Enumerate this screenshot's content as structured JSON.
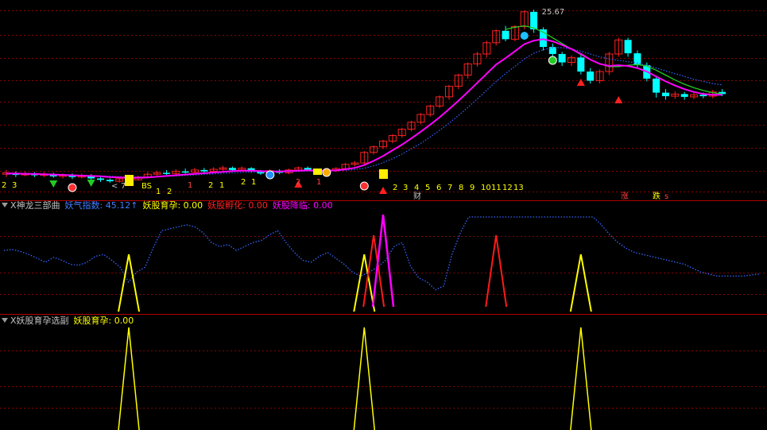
{
  "colors": {
    "background": "#000000",
    "grid": "#8a0000",
    "candle_up": "#ff2020",
    "candle_down": "#00ffff",
    "ma_fast": "#ff00ff",
    "ma_slow": "#4b7bff",
    "ma_green": "#22cc22",
    "ma_blue_dots": "#3366ff",
    "yellow": "#ffff00",
    "red": "#ff1a1a",
    "magenta": "#ff00ff",
    "label_gray": "#c0c0c0"
  },
  "main_panel": {
    "price_label": "25.67",
    "count_labels": [
      "2",
      "3",
      "1",
      "2",
      "1",
      "2",
      "1",
      "2",
      "1",
      "2",
      "1",
      "2",
      "3",
      "4",
      "5",
      "6",
      "7",
      "8",
      "9",
      "10",
      "11",
      "12",
      "13"
    ],
    "misc_labels": {
      "lt": "<",
      "seven": "7",
      "bs": "BS",
      "cai": "财",
      "zhang": "涨",
      "die": "跌",
      "s": "s"
    }
  },
  "panel2": {
    "name": "X神龙三部曲",
    "items": [
      {
        "label": "妖气指数: 45.12↑",
        "color": "#3f7fff"
      },
      {
        "label": "妖股育孕: 0.00",
        "color": "#ffff00"
      },
      {
        "label": "妖股孵化: 0.00",
        "color": "#ff2020"
      },
      {
        "label": "妖股降临: 0.00",
        "color": "#ff00ff"
      }
    ]
  },
  "panel3": {
    "name": "X妖股育孕选副",
    "items": [
      {
        "label": "妖股育孕: 0.00",
        "color": "#ffff00"
      }
    ]
  },
  "chart_data": {
    "type": "candlestick",
    "title": "",
    "candles": [
      {
        "o": 0.78,
        "c": 0.82,
        "h": 0.9,
        "l": 0.7
      },
      {
        "o": 0.82,
        "c": 0.76,
        "h": 0.86,
        "l": 0.7
      },
      {
        "o": 0.76,
        "c": 0.8,
        "h": 0.86,
        "l": 0.72
      },
      {
        "o": 0.8,
        "c": 0.75,
        "h": 0.84,
        "l": 0.7
      },
      {
        "o": 0.75,
        "c": 0.78,
        "h": 0.84,
        "l": 0.7
      },
      {
        "o": 0.78,
        "c": 0.72,
        "h": 0.82,
        "l": 0.68
      },
      {
        "o": 0.72,
        "c": 0.76,
        "h": 0.8,
        "l": 0.66
      },
      {
        "o": 0.76,
        "c": 0.7,
        "h": 0.8,
        "l": 0.64
      },
      {
        "o": 0.7,
        "c": 0.74,
        "h": 0.8,
        "l": 0.66
      },
      {
        "o": 0.74,
        "c": 0.66,
        "h": 0.78,
        "l": 0.6
      },
      {
        "o": 0.66,
        "c": 0.62,
        "h": 0.7,
        "l": 0.56
      },
      {
        "o": 0.62,
        "c": 0.58,
        "h": 0.66,
        "l": 0.54
      },
      {
        "o": 0.58,
        "c": 0.65,
        "h": 0.7,
        "l": 0.54
      },
      {
        "o": 0.65,
        "c": 0.62,
        "h": 0.72,
        "l": 0.58
      },
      {
        "o": 0.62,
        "c": 0.7,
        "h": 0.74,
        "l": 0.6
      },
      {
        "o": 0.7,
        "c": 0.78,
        "h": 0.84,
        "l": 0.66
      },
      {
        "o": 0.78,
        "c": 0.82,
        "h": 0.88,
        "l": 0.74
      },
      {
        "o": 0.82,
        "c": 0.8,
        "h": 0.9,
        "l": 0.76
      },
      {
        "o": 0.8,
        "c": 0.86,
        "h": 0.92,
        "l": 0.76
      },
      {
        "o": 0.86,
        "c": 0.84,
        "h": 0.94,
        "l": 0.8
      },
      {
        "o": 0.84,
        "c": 0.9,
        "h": 0.96,
        "l": 0.8
      },
      {
        "o": 0.9,
        "c": 0.86,
        "h": 0.96,
        "l": 0.82
      },
      {
        "o": 0.86,
        "c": 0.92,
        "h": 0.98,
        "l": 0.82
      },
      {
        "o": 0.92,
        "c": 0.96,
        "h": 1.02,
        "l": 0.88
      },
      {
        "o": 0.96,
        "c": 0.9,
        "h": 1.0,
        "l": 0.86
      },
      {
        "o": 0.9,
        "c": 0.95,
        "h": 1.0,
        "l": 0.86
      },
      {
        "o": 0.95,
        "c": 0.86,
        "h": 0.98,
        "l": 0.82
      },
      {
        "o": 0.86,
        "c": 0.8,
        "h": 0.9,
        "l": 0.76
      },
      {
        "o": 0.8,
        "c": 0.88,
        "h": 0.92,
        "l": 0.76
      },
      {
        "o": 0.88,
        "c": 0.82,
        "h": 0.92,
        "l": 0.78
      },
      {
        "o": 0.82,
        "c": 0.9,
        "h": 0.94,
        "l": 0.78
      },
      {
        "o": 0.9,
        "c": 0.96,
        "h": 1.0,
        "l": 0.86
      },
      {
        "o": 0.96,
        "c": 0.9,
        "h": 1.0,
        "l": 0.86
      },
      {
        "o": 0.9,
        "c": 0.8,
        "h": 0.94,
        "l": 0.76
      },
      {
        "o": 0.8,
        "c": 0.88,
        "h": 0.92,
        "l": 0.76
      },
      {
        "o": 0.88,
        "c": 0.94,
        "h": 0.98,
        "l": 0.84
      },
      {
        "o": 0.94,
        "c": 1.06,
        "h": 1.1,
        "l": 0.9
      },
      {
        "o": 1.06,
        "c": 1.1,
        "h": 1.16,
        "l": 1.0
      },
      {
        "o": 1.1,
        "c": 1.4,
        "h": 1.44,
        "l": 1.06
      },
      {
        "o": 1.4,
        "c": 1.56,
        "h": 1.6,
        "l": 1.34
      },
      {
        "o": 1.56,
        "c": 1.72,
        "h": 1.76,
        "l": 1.5
      },
      {
        "o": 1.72,
        "c": 1.88,
        "h": 1.92,
        "l": 1.66
      },
      {
        "o": 1.88,
        "c": 2.06,
        "h": 2.1,
        "l": 1.82
      },
      {
        "o": 2.06,
        "c": 2.26,
        "h": 2.3,
        "l": 2.0
      },
      {
        "o": 2.26,
        "c": 2.48,
        "h": 2.52,
        "l": 2.2
      },
      {
        "o": 2.48,
        "c": 2.72,
        "h": 2.76,
        "l": 2.42
      },
      {
        "o": 2.72,
        "c": 2.98,
        "h": 3.02,
        "l": 2.66
      },
      {
        "o": 2.98,
        "c": 3.28,
        "h": 3.32,
        "l": 2.9
      },
      {
        "o": 3.28,
        "c": 3.6,
        "h": 3.64,
        "l": 3.2
      },
      {
        "o": 3.6,
        "c": 3.92,
        "h": 3.96,
        "l": 3.5
      },
      {
        "o": 3.92,
        "c": 4.2,
        "h": 4.26,
        "l": 3.84
      },
      {
        "o": 4.2,
        "c": 4.52,
        "h": 4.58,
        "l": 4.1
      },
      {
        "o": 4.52,
        "c": 4.86,
        "h": 4.9,
        "l": 4.44
      },
      {
        "o": 4.86,
        "c": 4.62,
        "h": 5.0,
        "l": 4.56
      },
      {
        "o": 4.62,
        "c": 4.98,
        "h": 5.02,
        "l": 4.56
      },
      {
        "o": 4.98,
        "c": 5.4,
        "h": 5.44,
        "l": 4.9
      },
      {
        "o": 5.4,
        "c": 4.9,
        "h": 5.46,
        "l": 4.8
      },
      {
        "o": 4.9,
        "c": 4.4,
        "h": 4.96,
        "l": 4.3
      },
      {
        "o": 4.4,
        "c": 4.2,
        "h": 4.5,
        "l": 4.06
      },
      {
        "o": 4.2,
        "c": 3.96,
        "h": 4.26,
        "l": 3.86
      },
      {
        "o": 3.96,
        "c": 4.1,
        "h": 4.16,
        "l": 3.86
      },
      {
        "o": 4.1,
        "c": 3.7,
        "h": 4.16,
        "l": 3.62
      },
      {
        "o": 3.7,
        "c": 3.44,
        "h": 3.8,
        "l": 3.36
      },
      {
        "o": 3.44,
        "c": 3.7,
        "h": 3.76,
        "l": 3.36
      },
      {
        "o": 3.7,
        "c": 4.2,
        "h": 4.26,
        "l": 3.6
      },
      {
        "o": 4.2,
        "c": 4.6,
        "h": 4.66,
        "l": 4.12
      },
      {
        "o": 4.6,
        "c": 4.22,
        "h": 4.66,
        "l": 4.12
      },
      {
        "o": 4.22,
        "c": 3.88,
        "h": 4.3,
        "l": 3.8
      },
      {
        "o": 3.88,
        "c": 3.5,
        "h": 3.96,
        "l": 3.42
      },
      {
        "o": 3.5,
        "c": 3.1,
        "h": 3.56,
        "l": 2.96
      },
      {
        "o": 3.1,
        "c": 3.0,
        "h": 3.2,
        "l": 2.9
      },
      {
        "o": 3.0,
        "c": 3.06,
        "h": 3.14,
        "l": 2.92
      },
      {
        "o": 3.06,
        "c": 2.98,
        "h": 3.12,
        "l": 2.9
      },
      {
        "o": 2.98,
        "c": 3.04,
        "h": 3.1,
        "l": 2.92
      },
      {
        "o": 3.04,
        "c": 3.0,
        "h": 3.1,
        "l": 2.94
      },
      {
        "o": 3.0,
        "c": 3.12,
        "h": 3.18,
        "l": 2.94
      },
      {
        "o": 3.12,
        "c": 3.06,
        "h": 3.2,
        "l": 3.0
      }
    ],
    "ma_fast": [
      0.8,
      0.8,
      0.79,
      0.79,
      0.78,
      0.77,
      0.76,
      0.75,
      0.74,
      0.73,
      0.72,
      0.7,
      0.69,
      0.68,
      0.68,
      0.69,
      0.71,
      0.73,
      0.75,
      0.77,
      0.79,
      0.81,
      0.83,
      0.85,
      0.87,
      0.88,
      0.88,
      0.87,
      0.86,
      0.86,
      0.87,
      0.88,
      0.89,
      0.88,
      0.88,
      0.89,
      0.92,
      0.96,
      1.04,
      1.16,
      1.3,
      1.46,
      1.62,
      1.8,
      1.99,
      2.19,
      2.4,
      2.63,
      2.87,
      3.12,
      3.38,
      3.64,
      3.9,
      4.08,
      4.28,
      4.48,
      4.58,
      4.62,
      4.56,
      4.46,
      4.34,
      4.2,
      4.04,
      3.92,
      3.86,
      3.88,
      3.86,
      3.8,
      3.7,
      3.56,
      3.42,
      3.3,
      3.2,
      3.12,
      3.06,
      3.04,
      3.04
    ],
    "ma_blue": [
      0.78,
      0.78,
      0.78,
      0.77,
      0.77,
      0.76,
      0.76,
      0.75,
      0.74,
      0.74,
      0.73,
      0.72,
      0.71,
      0.7,
      0.7,
      0.7,
      0.71,
      0.72,
      0.73,
      0.75,
      0.76,
      0.78,
      0.79,
      0.81,
      0.82,
      0.83,
      0.84,
      0.84,
      0.84,
      0.85,
      0.85,
      0.86,
      0.87,
      0.87,
      0.87,
      0.88,
      0.89,
      0.91,
      0.95,
      1.02,
      1.11,
      1.22,
      1.35,
      1.5,
      1.66,
      1.84,
      2.03,
      2.23,
      2.45,
      2.68,
      2.92,
      3.17,
      3.42,
      3.64,
      3.85,
      4.06,
      4.22,
      4.32,
      4.38,
      4.38,
      4.34,
      4.28,
      4.2,
      4.12,
      4.06,
      4.02,
      3.98,
      3.94,
      3.88,
      3.8,
      3.72,
      3.64,
      3.56,
      3.48,
      3.42,
      3.36,
      3.32
    ],
    "ma_green": [
      null,
      null,
      null,
      null,
      null,
      null,
      null,
      null,
      null,
      null,
      null,
      null,
      null,
      null,
      null,
      null,
      null,
      null,
      null,
      null,
      null,
      null,
      null,
      null,
      null,
      null,
      null,
      null,
      null,
      null,
      null,
      null,
      null,
      null,
      null,
      null,
      null,
      null,
      null,
      null,
      null,
      null,
      null,
      null,
      null,
      null,
      null,
      null,
      null,
      null,
      null,
      null,
      null,
      4.9,
      4.96,
      5.0,
      4.94,
      4.82,
      4.66,
      4.5,
      4.34,
      4.18,
      4.04,
      3.92,
      3.84,
      3.84,
      3.88,
      3.9,
      3.86,
      3.74,
      3.6,
      3.46,
      3.34,
      3.24,
      3.16,
      3.1,
      3.06
    ],
    "yaoqi_index": [
      62,
      63,
      61,
      58,
      54,
      50,
      55,
      52,
      48,
      47,
      50,
      56,
      58,
      52,
      45,
      30,
      40,
      45,
      65,
      82,
      84,
      86,
      88,
      86,
      80,
      70,
      66,
      68,
      62,
      66,
      70,
      72,
      78,
      82,
      70,
      60,
      52,
      50,
      56,
      60,
      54,
      48,
      40,
      36,
      40,
      45,
      52,
      66,
      70,
      46,
      34,
      30,
      22,
      26,
      58,
      80,
      96,
      96,
      96,
      96,
      96,
      96,
      96,
      96,
      96,
      96,
      96,
      96,
      96,
      96,
      96,
      96,
      88,
      78,
      70,
      64,
      60,
      58,
      56,
      54,
      52,
      50,
      48,
      44,
      40,
      38,
      36,
      36,
      36,
      36,
      37,
      38
    ],
    "yaoqi_scale": {
      "ymin": 0,
      "ymax": 100
    },
    "yuyun_spikes": [
      13,
      38,
      61
    ],
    "fuhua_spikes": [
      39,
      52
    ],
    "jianglin_spikes": [
      40
    ]
  }
}
